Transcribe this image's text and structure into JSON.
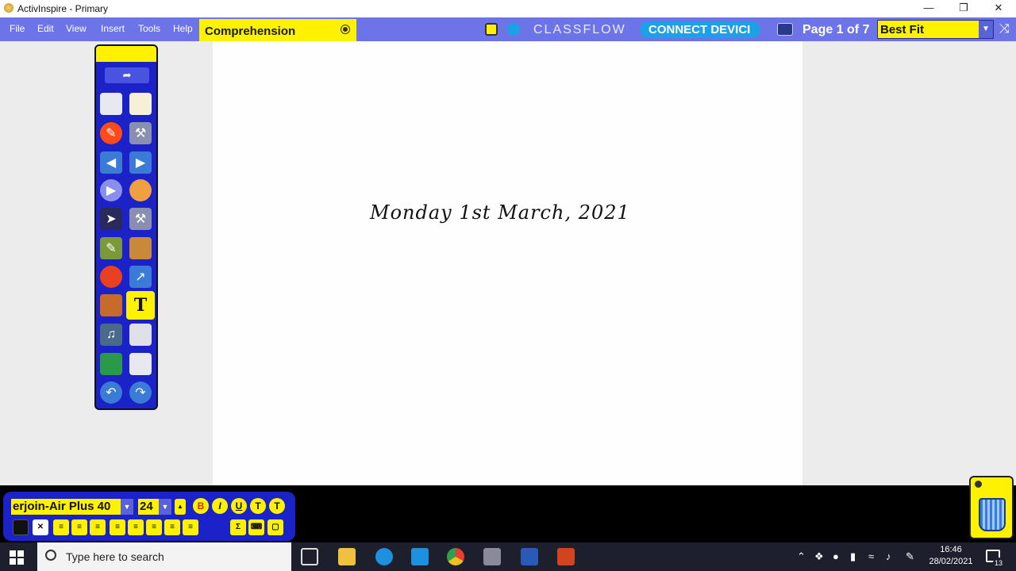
{
  "window": {
    "title": "ActivInspire - Primary"
  },
  "menu": [
    "File",
    "Edit",
    "View",
    "Insert",
    "Tools",
    "Help"
  ],
  "flipchart_tab": {
    "label": "Comprehension"
  },
  "header": {
    "classflow": "CLASSFLOW",
    "connect_label": "CONNECT DEVICI",
    "page_label": "Page 1 of 7",
    "zoom_value": "Best Fit"
  },
  "page": {
    "date_text": "Monday 1st March, 2021"
  },
  "text_toolbar": {
    "font": "erjoin-Air Plus 40",
    "size": "24",
    "bold": "B",
    "italic": "I",
    "underline": "U"
  },
  "taskbar": {
    "search_placeholder": "Type here to search",
    "time": "16:46",
    "date": "28/02/2021",
    "notifications": "13"
  },
  "colors": {
    "accent": "#6c74e8",
    "highlight": "#fff200",
    "toolbox": "#1a22c8",
    "connect": "#1ea0e6"
  }
}
